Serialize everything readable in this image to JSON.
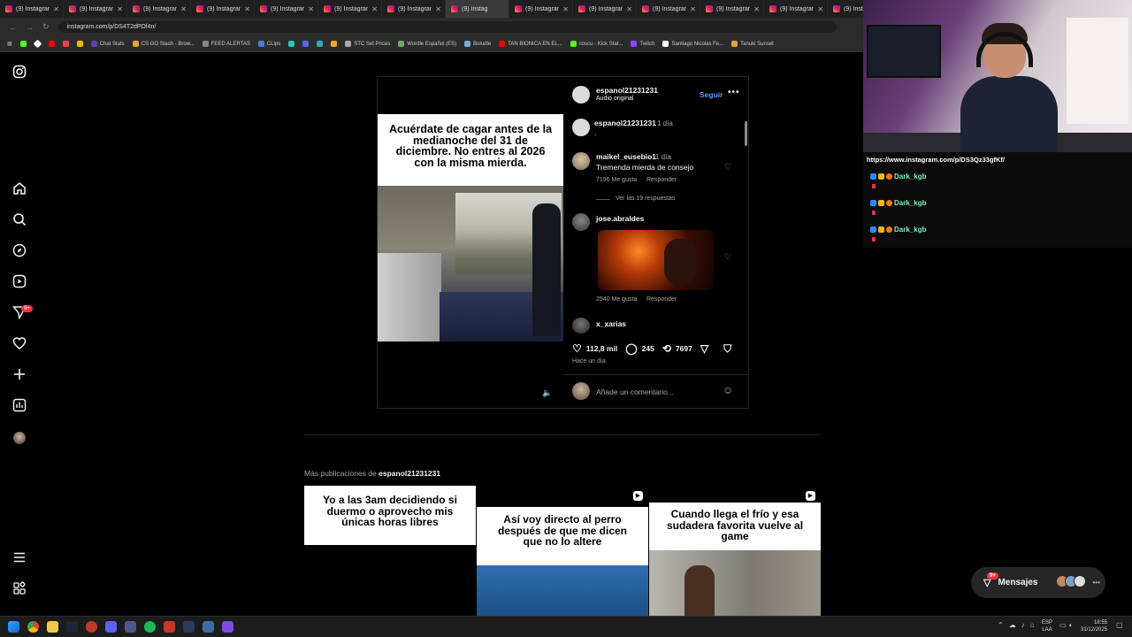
{
  "browser": {
    "tab_label": "(9) Instagram",
    "active_tab_label": "(9) Instag",
    "tab_count": 14,
    "url": "instagram.com/p/DS4T2dPDf4n/",
    "bookmarks": [
      "Chat Stats",
      "CS:GO Stash - Brow...",
      "FEED ALERTAS",
      "CLips",
      "STC Set Prices",
      "Wordle Español (ES)",
      "Boludle",
      "TAN BIONICA EN EL...",
      "coscu - Kick Stat...",
      "Twitch",
      "Santiago Nicolas Fe...",
      "Tanuki Sunset"
    ]
  },
  "nav": {
    "notification_badge": "9+"
  },
  "post": {
    "author": "espanol21231231",
    "audio": "Audio original",
    "follow_label": "Seguir",
    "media_caption": "Acuérdate de cagar antes de la medianoche del 31 de diciembre. No entres al 2026 con la misma mierda.",
    "caption_author": "espanol21231231",
    "caption_time": "1 día",
    "caption_text": ".",
    "comments": [
      {
        "user": "maikel_eusebio1",
        "time": "1 día",
        "text": "Tremenda mierda de consejo",
        "likes": "7196 Me gusta",
        "reply": "Responder",
        "view_replies": "Ver las 19 respuestas"
      },
      {
        "user": "jose.abraldes",
        "likes": "2540 Me gusta",
        "reply": "Responder"
      },
      {
        "user": "x_xarias"
      }
    ],
    "likes": "112,8 mil",
    "comment_count": "245",
    "reposts": "7697",
    "posted": "Hace un día",
    "comment_placeholder": "Añade un comentario..."
  },
  "more": {
    "label_prefix": "Más publicaciones de",
    "label_user": "espanol21231231",
    "posts": [
      {
        "caption": "Yo a las 3am decidiendo si duermo o aprovecho mis únicas horas libres"
      },
      {
        "caption": "Así voy directo al perro después de que me dicen que no lo altere"
      },
      {
        "caption": "Cuando llega el frío y esa sudadera favorita vuelve al game"
      }
    ]
  },
  "messages": {
    "label": "Mensajes",
    "badge": "9+"
  },
  "stream": {
    "chat_url": "https://www.instagram.com/p/DS3Qz33gfKf/",
    "chat_users": [
      "Dark_kgb",
      "Dark_kgb",
      "Dark_kgb"
    ]
  },
  "taskbar": {
    "lang_top": "ESP",
    "lang_bottom": "LAA",
    "time": "18:55",
    "date": "31/12/2025"
  },
  "colors": {
    "link_blue": "#4a9eff",
    "badge_red": "#ff3040",
    "chat_green": "#7ef0b8"
  }
}
